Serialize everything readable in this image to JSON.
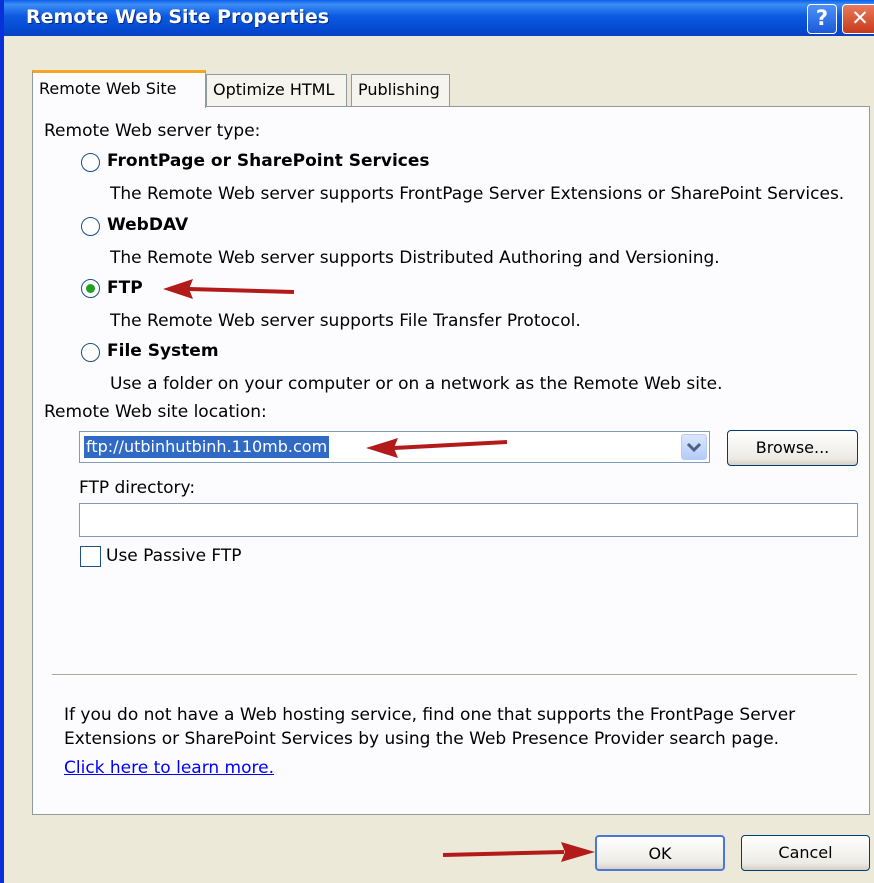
{
  "window": {
    "title": "Remote Web Site Properties",
    "help_label": "?",
    "close_label": "✕"
  },
  "tabs": [
    {
      "label": "Remote Web Site",
      "active": true
    },
    {
      "label": "Optimize HTML",
      "active": false
    },
    {
      "label": "Publishing",
      "active": false
    }
  ],
  "server_type": {
    "heading": "Remote Web server type:",
    "options": [
      {
        "label": "FrontPage or SharePoint Services",
        "description": "The Remote Web server supports FrontPage Server Extensions or SharePoint Services.",
        "selected": false
      },
      {
        "label": "WebDAV",
        "description": "The Remote Web server supports Distributed Authoring and Versioning.",
        "selected": false
      },
      {
        "label": "FTP",
        "description": "The Remote Web server supports File Transfer Protocol.",
        "selected": true
      },
      {
        "label": "File System",
        "description": "Use a folder on your computer or on a network as the Remote Web site.",
        "selected": false
      }
    ]
  },
  "location": {
    "label": "Remote Web site location:",
    "value": "ftp://utbinhutbinh.110mb.com",
    "browse_label": "Browse..."
  },
  "ftp_directory": {
    "label": "FTP directory:",
    "value": ""
  },
  "passive_ftp": {
    "label": "Use Passive FTP",
    "checked": false
  },
  "info": {
    "line1": "If you do not have a Web hosting service, find one that supports the FrontPage Server",
    "line2": "Extensions or SharePoint Services by using the Web Presence Provider search page.",
    "link": "Click here to learn more."
  },
  "footer": {
    "ok_label": "OK",
    "cancel_label": "Cancel"
  },
  "colors": {
    "annotation_arrow": "#b31b1b",
    "titlebar": "#0a5ae0",
    "selection": "#316ac5"
  }
}
